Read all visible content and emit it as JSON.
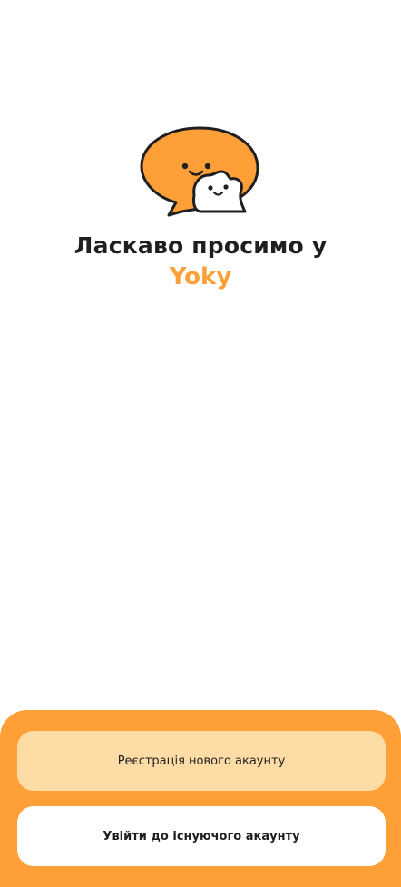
{
  "welcome": {
    "title": "Ласкаво просимо у",
    "brand": "Yoky"
  },
  "logo": {
    "icon": "chat-bubbles-mascot-icon"
  },
  "actions": {
    "register_label": "Реєстрація нового акаунту",
    "login_label": "Увійти до існуючого акаунту"
  },
  "colors": {
    "accent": "#ff9f38",
    "register_button": "#fedca6",
    "login_button": "#ffffff",
    "text": "#1f1f1f"
  }
}
